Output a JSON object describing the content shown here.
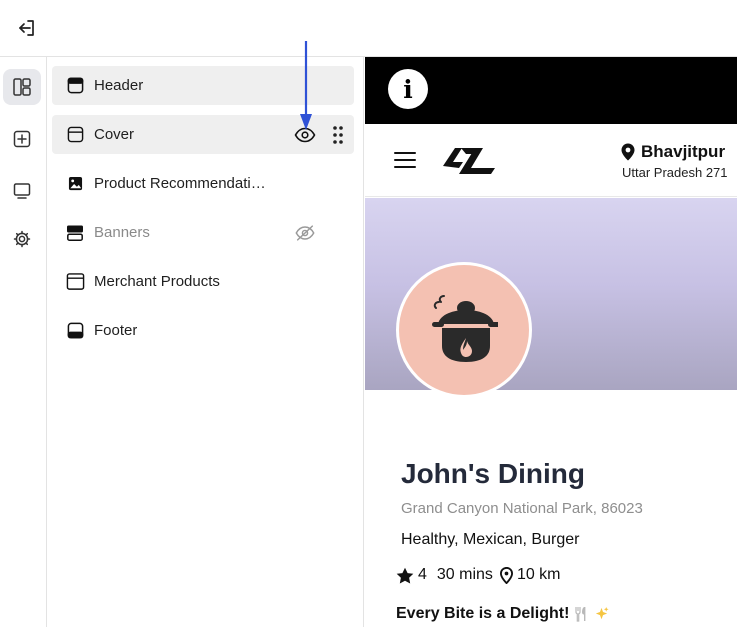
{
  "sidebar_sections": [
    {
      "label": "Header",
      "icon": "header-section-icon",
      "highlighted": true,
      "hidden": false
    },
    {
      "label": "Cover",
      "icon": "cover-section-icon",
      "highlighted": true,
      "hidden": false
    },
    {
      "label": "Product Recommendations",
      "icon": "image-section-icon",
      "highlighted": false,
      "hidden": false
    },
    {
      "label": "Banners",
      "icon": "banners-section-icon",
      "highlighted": false,
      "hidden": true
    },
    {
      "label": "Merchant Products",
      "icon": "merchant-products-section-icon",
      "highlighted": false,
      "hidden": false
    },
    {
      "label": "Footer",
      "icon": "footer-section-icon",
      "highlighted": false,
      "hidden": false
    }
  ],
  "rail_icons": [
    "layout-icon",
    "add-section-icon",
    "preview-monitor-icon",
    "settings-gear-icon"
  ],
  "topbar": {
    "icon": "exit-icon"
  },
  "preview": {
    "info_glyph": "i",
    "location": {
      "city": "Bhavjitpur",
      "state": "Uttar Pradesh 271"
    },
    "restaurant": {
      "name": "John's Dining",
      "address": "Grand Canyon National Park, 86023",
      "cuisines": "Healthy, Mexican, Burger",
      "rating": "4",
      "delivery_time": "30 mins",
      "distance": "10 km",
      "tagline": "Every Bite is a Delight!"
    }
  },
  "colors": {
    "accent_arrow": "#2f52d6",
    "avatar_bg": "#f4c1b2",
    "info_bar": "#000000",
    "active_rail": "#e7e8ec",
    "section_highlight": "#efefef"
  }
}
